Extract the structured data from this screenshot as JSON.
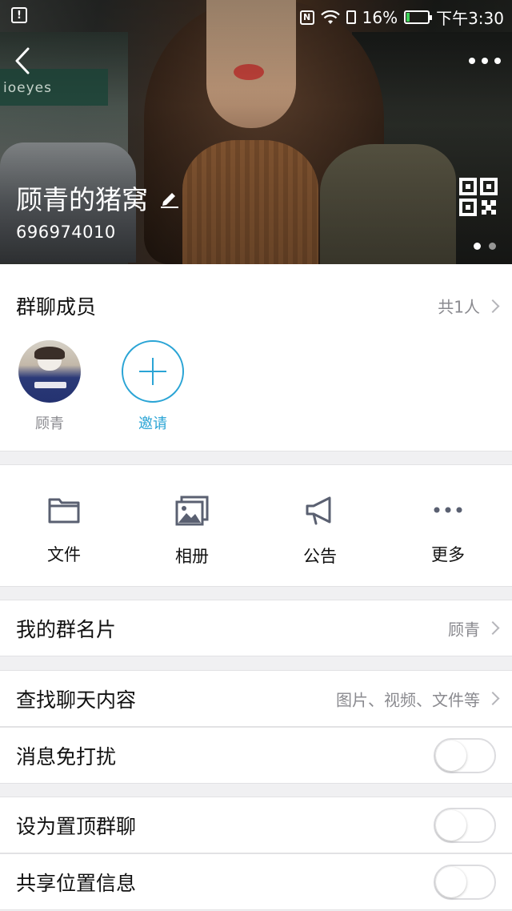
{
  "status_bar": {
    "alert_glyph": "!",
    "nfc_label": "N",
    "battery": "16%",
    "battery_level": 0.16,
    "time": "下午3:30"
  },
  "header": {
    "group_name": "顾青的猪窝",
    "group_id": "696974010",
    "photo_scene_sign": "ioeyes",
    "pager_total": 2,
    "pager_active": 1
  },
  "members": {
    "title": "群聊成员",
    "count_label": "共1人",
    "list": [
      {
        "name": "顾青"
      }
    ],
    "invite_label": "邀请"
  },
  "actions": [
    {
      "label": "文件",
      "icon": "folder-icon"
    },
    {
      "label": "相册",
      "icon": "photo-album-icon"
    },
    {
      "label": "公告",
      "icon": "megaphone-icon"
    },
    {
      "label": "更多",
      "icon": "more-dots-icon"
    }
  ],
  "settings": {
    "my_card": {
      "label": "我的群名片",
      "value": "顾青"
    },
    "search_chat": {
      "label": "查找聊天内容",
      "value": "图片、视频、文件等"
    },
    "mute": {
      "label": "消息免打扰",
      "on": false
    },
    "pin_top": {
      "label": "设为置顶群聊",
      "on": false
    },
    "share_location": {
      "label": "共享位置信息",
      "on": false
    }
  },
  "colors": {
    "accent": "#2aa4d5",
    "secondary_text": "#8a8a8f",
    "divider": "#e2e2e4",
    "background": "#f0f0f2"
  }
}
